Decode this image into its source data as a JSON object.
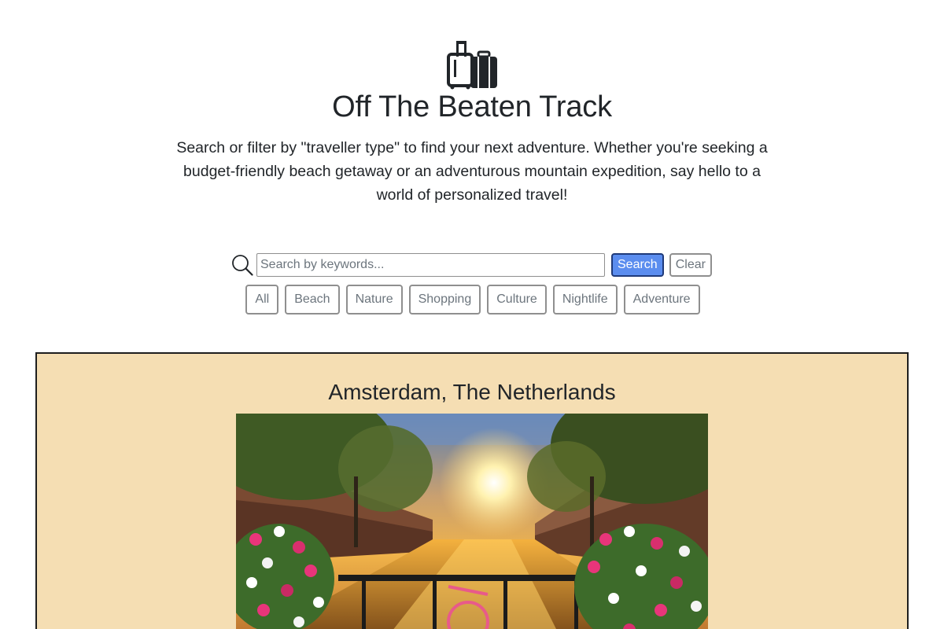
{
  "header": {
    "logo_icon": "luggage-icon",
    "title": "Off The Beaten Track",
    "tagline": "Search or filter by \"traveller type\" to find your next adventure. Whether you're seeking a budget-friendly beach getaway or an adventurous mountain expedition, say hello to a world of personalized travel!"
  },
  "search": {
    "icon": "search-icon",
    "placeholder": "Search by keywords...",
    "value": "",
    "search_label": "Search",
    "clear_label": "Clear"
  },
  "filters": [
    "All",
    "Beach",
    "Nature",
    "Shopping",
    "Culture",
    "Nightlife",
    "Adventure"
  ],
  "destination": {
    "title": "Amsterdam, The Netherlands",
    "image": "amsterdam-canal-sunset-photo"
  },
  "colors": {
    "card_background": "#f5deb3",
    "search_button": "#5b8def",
    "text": "#212529"
  }
}
